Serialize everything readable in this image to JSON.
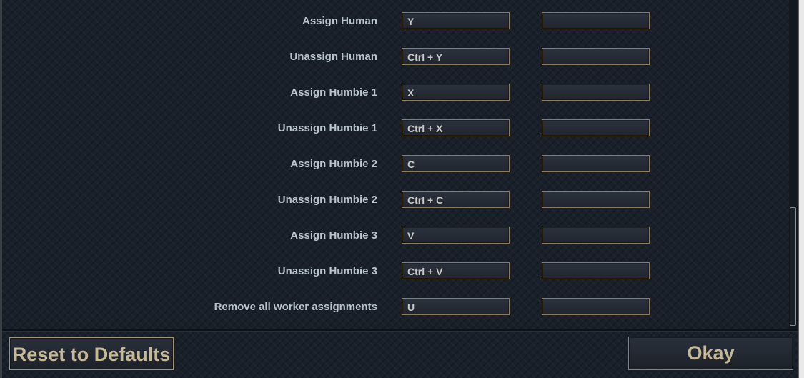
{
  "keybindings": {
    "rows": [
      {
        "action": "Assign Human",
        "primary": "Y",
        "secondary": ""
      },
      {
        "action": "Unassign Human",
        "primary": "Ctrl + Y",
        "secondary": ""
      },
      {
        "action": "Assign Humbie 1",
        "primary": "X",
        "secondary": ""
      },
      {
        "action": "Unassign Humbie 1",
        "primary": "Ctrl + X",
        "secondary": ""
      },
      {
        "action": "Assign Humbie 2",
        "primary": "C",
        "secondary": ""
      },
      {
        "action": "Unassign Humbie 2",
        "primary": "Ctrl + C",
        "secondary": ""
      },
      {
        "action": "Assign Humbie 3",
        "primary": "V",
        "secondary": ""
      },
      {
        "action": "Unassign Humbie 3",
        "primary": "Ctrl + V",
        "secondary": ""
      },
      {
        "action": "Remove all worker assignments",
        "primary": "U",
        "secondary": ""
      }
    ]
  },
  "footer": {
    "reset_label": "Reset to Defaults",
    "okay_label": "Okay"
  },
  "colors": {
    "label_text": "#b9c3cc",
    "key_border": "#8c7c5c",
    "button_text": "#c5b896",
    "background": "#19202a"
  }
}
